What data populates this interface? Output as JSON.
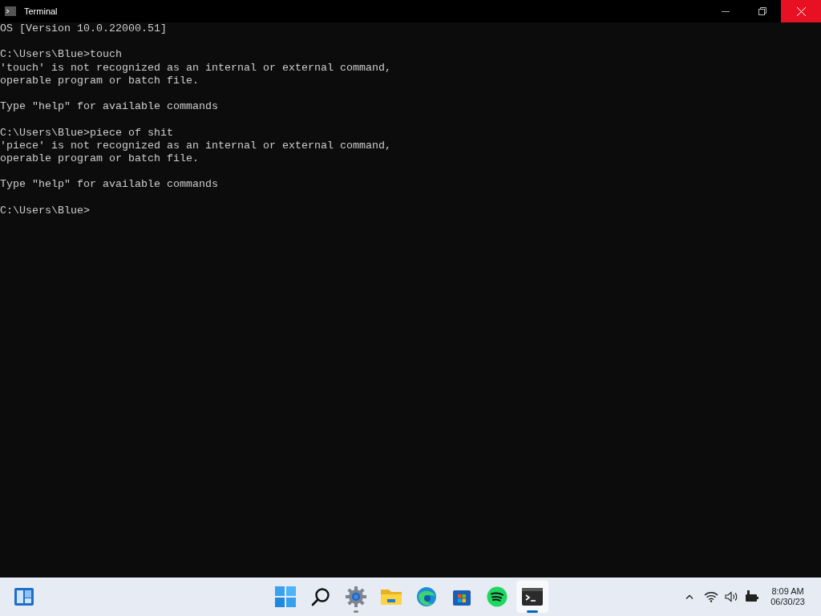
{
  "window": {
    "title": "Terminal",
    "close_hovered": true
  },
  "console": {
    "blocks": [
      [
        "OS [Version 10.0.22000.51]"
      ],
      [
        "C:\\Users\\Blue>touch",
        "'touch' is not recognized as an internal or external command,",
        "operable program or batch file."
      ],
      [
        "Type \"help\" for available commands"
      ],
      [
        "C:\\Users\\Blue>piece of shit",
        "'piece' is not recognized as an internal or external command,",
        "operable program or batch file."
      ],
      [
        "Type \"help\" for available commands"
      ],
      [
        "C:\\Users\\Blue>"
      ]
    ]
  },
  "taskbar": {
    "apps": [
      {
        "kind": "start",
        "running": false,
        "selected": false
      },
      {
        "kind": "search",
        "running": false,
        "selected": false
      },
      {
        "kind": "settings",
        "running": true,
        "selected": false
      },
      {
        "kind": "explorer",
        "running": false,
        "selected": false
      },
      {
        "kind": "edge",
        "running": false,
        "selected": false
      },
      {
        "kind": "store",
        "running": false,
        "selected": false
      },
      {
        "kind": "spotify",
        "running": false,
        "selected": false
      },
      {
        "kind": "terminal",
        "running": true,
        "selected": true
      }
    ],
    "clock": {
      "time": "8:09 AM",
      "date": "06/30/23"
    }
  }
}
